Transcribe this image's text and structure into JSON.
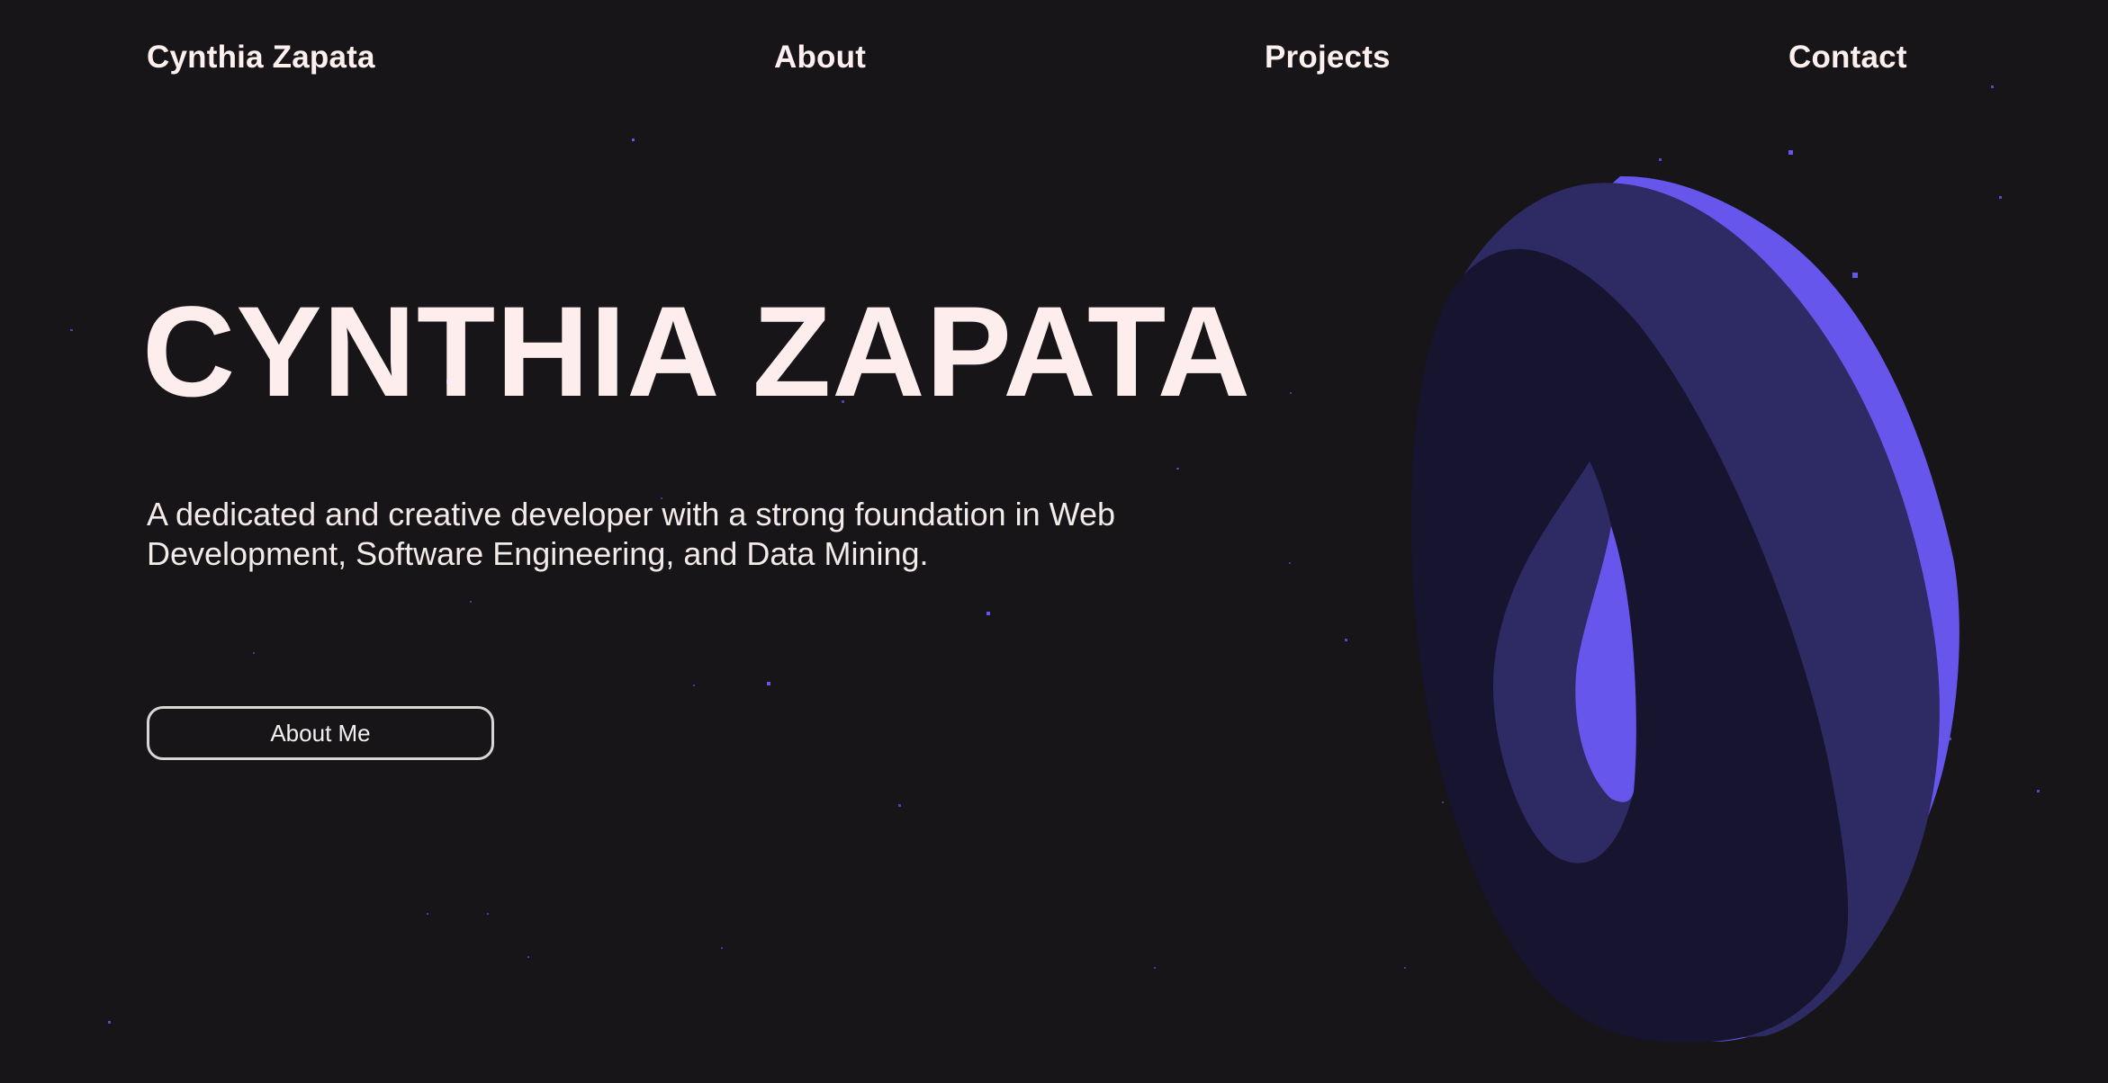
{
  "nav": {
    "brand": "Cynthia Zapata",
    "about": "About",
    "projects": "Projects",
    "contact": "Contact"
  },
  "hero": {
    "title": "CYNTHIA ZAPATA",
    "description": "A dedicated and creative developer with a strong foundation in Web Development, Software Engineering, and Data Mining.",
    "button_label": "About Me"
  },
  "colors": {
    "background": "#171518",
    "text": "#fdf0ef",
    "accent": "#6656ec",
    "ring_mid": "#2e2a63",
    "ring_dark": "#16142e"
  },
  "decor": {
    "illustration": "3d-torus-ring",
    "background_effect": "starfield"
  }
}
